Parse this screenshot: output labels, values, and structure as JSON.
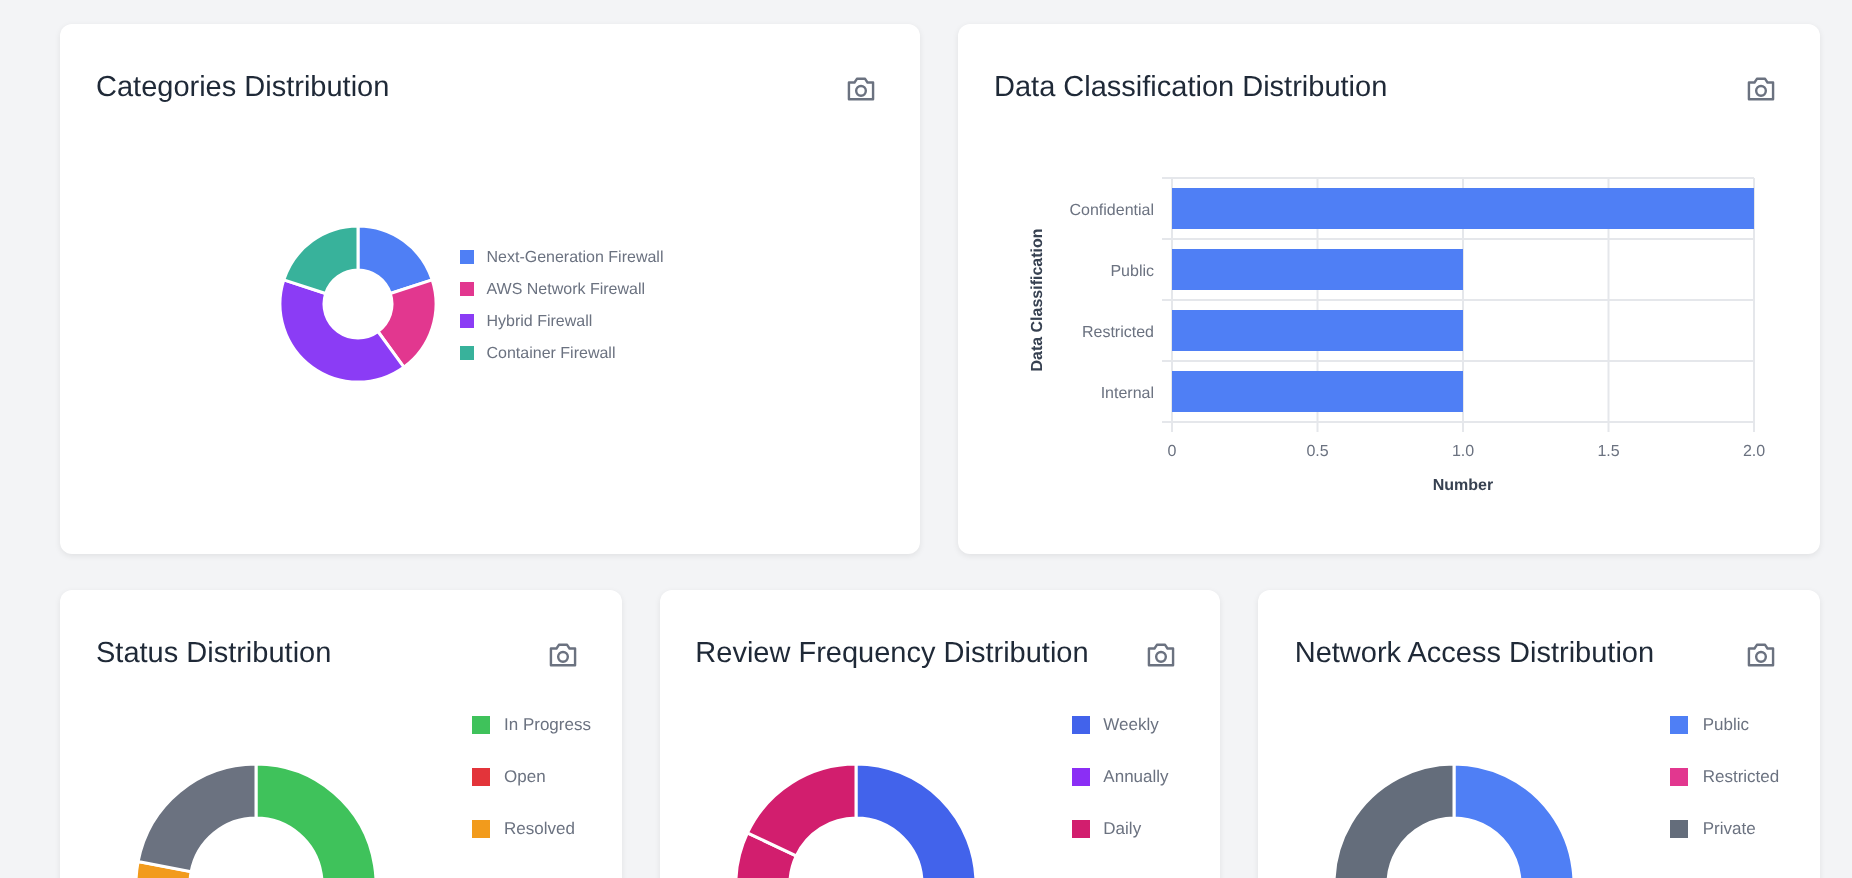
{
  "cards": [
    {
      "title": "Categories Distribution",
      "kind": "donut",
      "legend": [
        {
          "label": "Next-Generation Firewall",
          "color": "#4f7ff5"
        },
        {
          "label": "AWS Network Firewall",
          "color": "#e2378f"
        },
        {
          "label": "Hybrid Firewall",
          "color": "#8b3cf5"
        },
        {
          "label": "Container Firewall",
          "color": "#38b29b"
        }
      ]
    },
    {
      "title": "Data Classification Distribution",
      "kind": "bar",
      "chart_data": {
        "type": "bar",
        "orientation": "horizontal",
        "xlabel": "Number",
        "ylabel": "Data Classification",
        "categories": [
          "Confidential",
          "Public",
          "Restricted",
          "Internal"
        ],
        "grid": true,
        "series": [
          {
            "color": "#4f7ff5",
            "values": [
              2,
              1,
              1,
              1
            ]
          }
        ],
        "xlim": [
          0,
          2
        ],
        "xticks": [
          {
            "value": 0,
            "label": "0"
          },
          {
            "value": 0.5,
            "label": "0.5"
          },
          {
            "value": 1,
            "label": "1.0"
          },
          {
            "value": 1.5,
            "label": "1.5"
          },
          {
            "value": 2,
            "label": "2.0"
          }
        ]
      }
    },
    {
      "title": "Status Distribution",
      "kind": "donut-large",
      "legend": [
        {
          "label": "In Progress",
          "color": "#3fc25b"
        },
        {
          "label": "Open",
          "color": "#e3343a"
        },
        {
          "label": "Resolved",
          "color": "#f29b1c"
        }
      ]
    },
    {
      "title": "Review Frequency Distribution",
      "kind": "donut-large",
      "legend": [
        {
          "label": "Weekly",
          "color": "#4263eb"
        },
        {
          "label": "Annually",
          "color": "#8b2ef5"
        },
        {
          "label": "Daily",
          "color": "#d21e6e"
        }
      ]
    },
    {
      "title": "Network Access Distribution",
      "kind": "donut-large",
      "legend": [
        {
          "label": "Public",
          "color": "#4f7ff5"
        },
        {
          "label": "Restricted",
          "color": "#e2378f"
        },
        {
          "label": "Private",
          "color": "#646d7b"
        }
      ]
    }
  ]
}
